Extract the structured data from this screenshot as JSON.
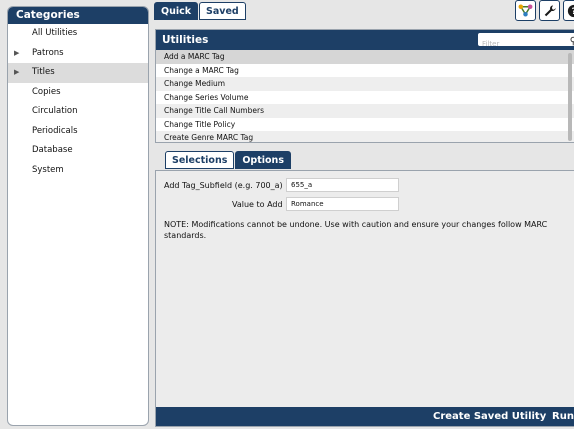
{
  "sidebar": {
    "header": "Categories",
    "items": [
      {
        "label": "All Utilities"
      },
      {
        "label": "Patrons"
      },
      {
        "label": "Titles"
      },
      {
        "label": "Copies"
      },
      {
        "label": "Circulation"
      },
      {
        "label": "Periodicals"
      },
      {
        "label": "Database"
      },
      {
        "label": "System"
      }
    ]
  },
  "top_tabs": [
    "Quick",
    "Saved"
  ],
  "utilities": {
    "title": "Utilities",
    "filter_placeholder": "Filter",
    "items": [
      "Add a MARC Tag",
      "Change a MARC Tag",
      "Change Medium",
      "Change Series Volume",
      "Change Title Call Numbers",
      "Change Title Policy",
      "Create Genre MARC Tag"
    ]
  },
  "sub_tabs": [
    "Selections",
    "Options"
  ],
  "options": {
    "tag_label": "Add Tag_Subfield (e.g. 700_a)",
    "tag_value": "655_a",
    "value_label": "Value to Add",
    "value_value": "Romance",
    "note": "NOTE: Modifications cannot be undone. Use with caution and ensure your changes follow MARC standards."
  },
  "footer": {
    "save_label": "Create Saved Utility",
    "run_label": "Run"
  },
  "icons": {
    "network": "network-icon",
    "wrench": "wrench-icon",
    "help": "help-icon",
    "search": "search-icon",
    "expand": "expand-arrow-icon"
  },
  "colors": {
    "primary": "#1d3f66",
    "network_icon": "#e8a400"
  }
}
